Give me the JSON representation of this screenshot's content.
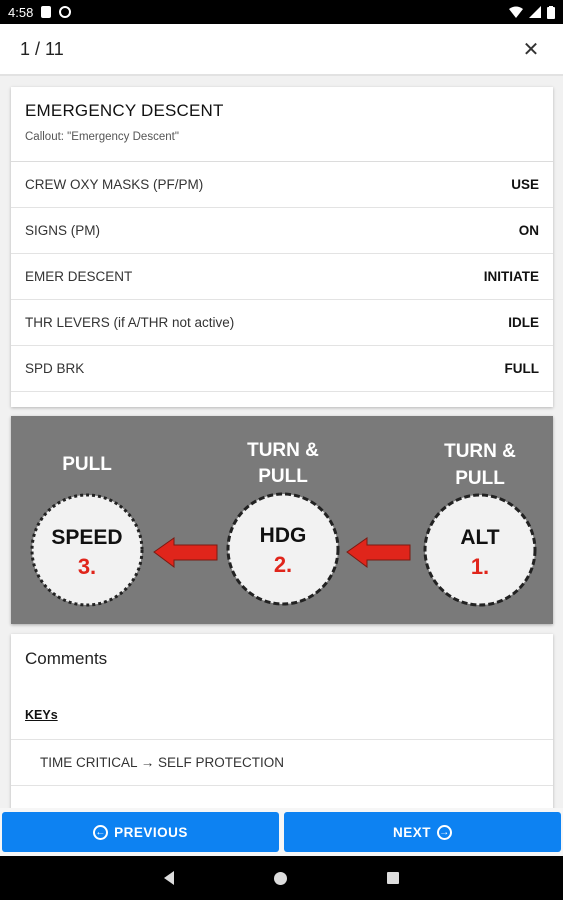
{
  "status_bar": {
    "time": "4:58",
    "icons": [
      "sd-card-icon",
      "sync-icon",
      "wifi-icon",
      "signal-icon",
      "battery-icon"
    ]
  },
  "top_bar": {
    "page_counter": "1 / 11",
    "close_icon": "close-icon"
  },
  "checklist": {
    "title": "EMERGENCY DESCENT",
    "callout": "Callout: \"Emergency Descent\"",
    "items": [
      {
        "item": "CREW OXY MASKS (PF/PM)",
        "action": "USE"
      },
      {
        "item": "SIGNS (PM)",
        "action": "ON"
      },
      {
        "item": "EMER DESCENT",
        "action": "INITIATE"
      },
      {
        "item": "THR LEVERS (if A/THR not active)",
        "action": "IDLE"
      },
      {
        "item": "SPD BRK",
        "action": "FULL"
      }
    ]
  },
  "diagram": {
    "background": "#7a7a7a",
    "arrow_color": "#e0251b",
    "knobs": [
      {
        "top_line1": "PULL",
        "top_line2": "",
        "name": "SPEED",
        "order": "3."
      },
      {
        "top_line1": "TURN &",
        "top_line2": "PULL",
        "name": "HDG",
        "order": "2."
      },
      {
        "top_line1": "TURN &",
        "top_line2": "PULL",
        "name": "ALT",
        "order": "1."
      }
    ]
  },
  "comments": {
    "heading": "Comments",
    "keys_label": "KEYs",
    "entries": [
      "TIME CRITICAL → SELF PROTECTION"
    ]
  },
  "navigation": {
    "previous_label": "PREVIOUS",
    "next_label": "NEXT",
    "accent": "#0d82f2"
  }
}
